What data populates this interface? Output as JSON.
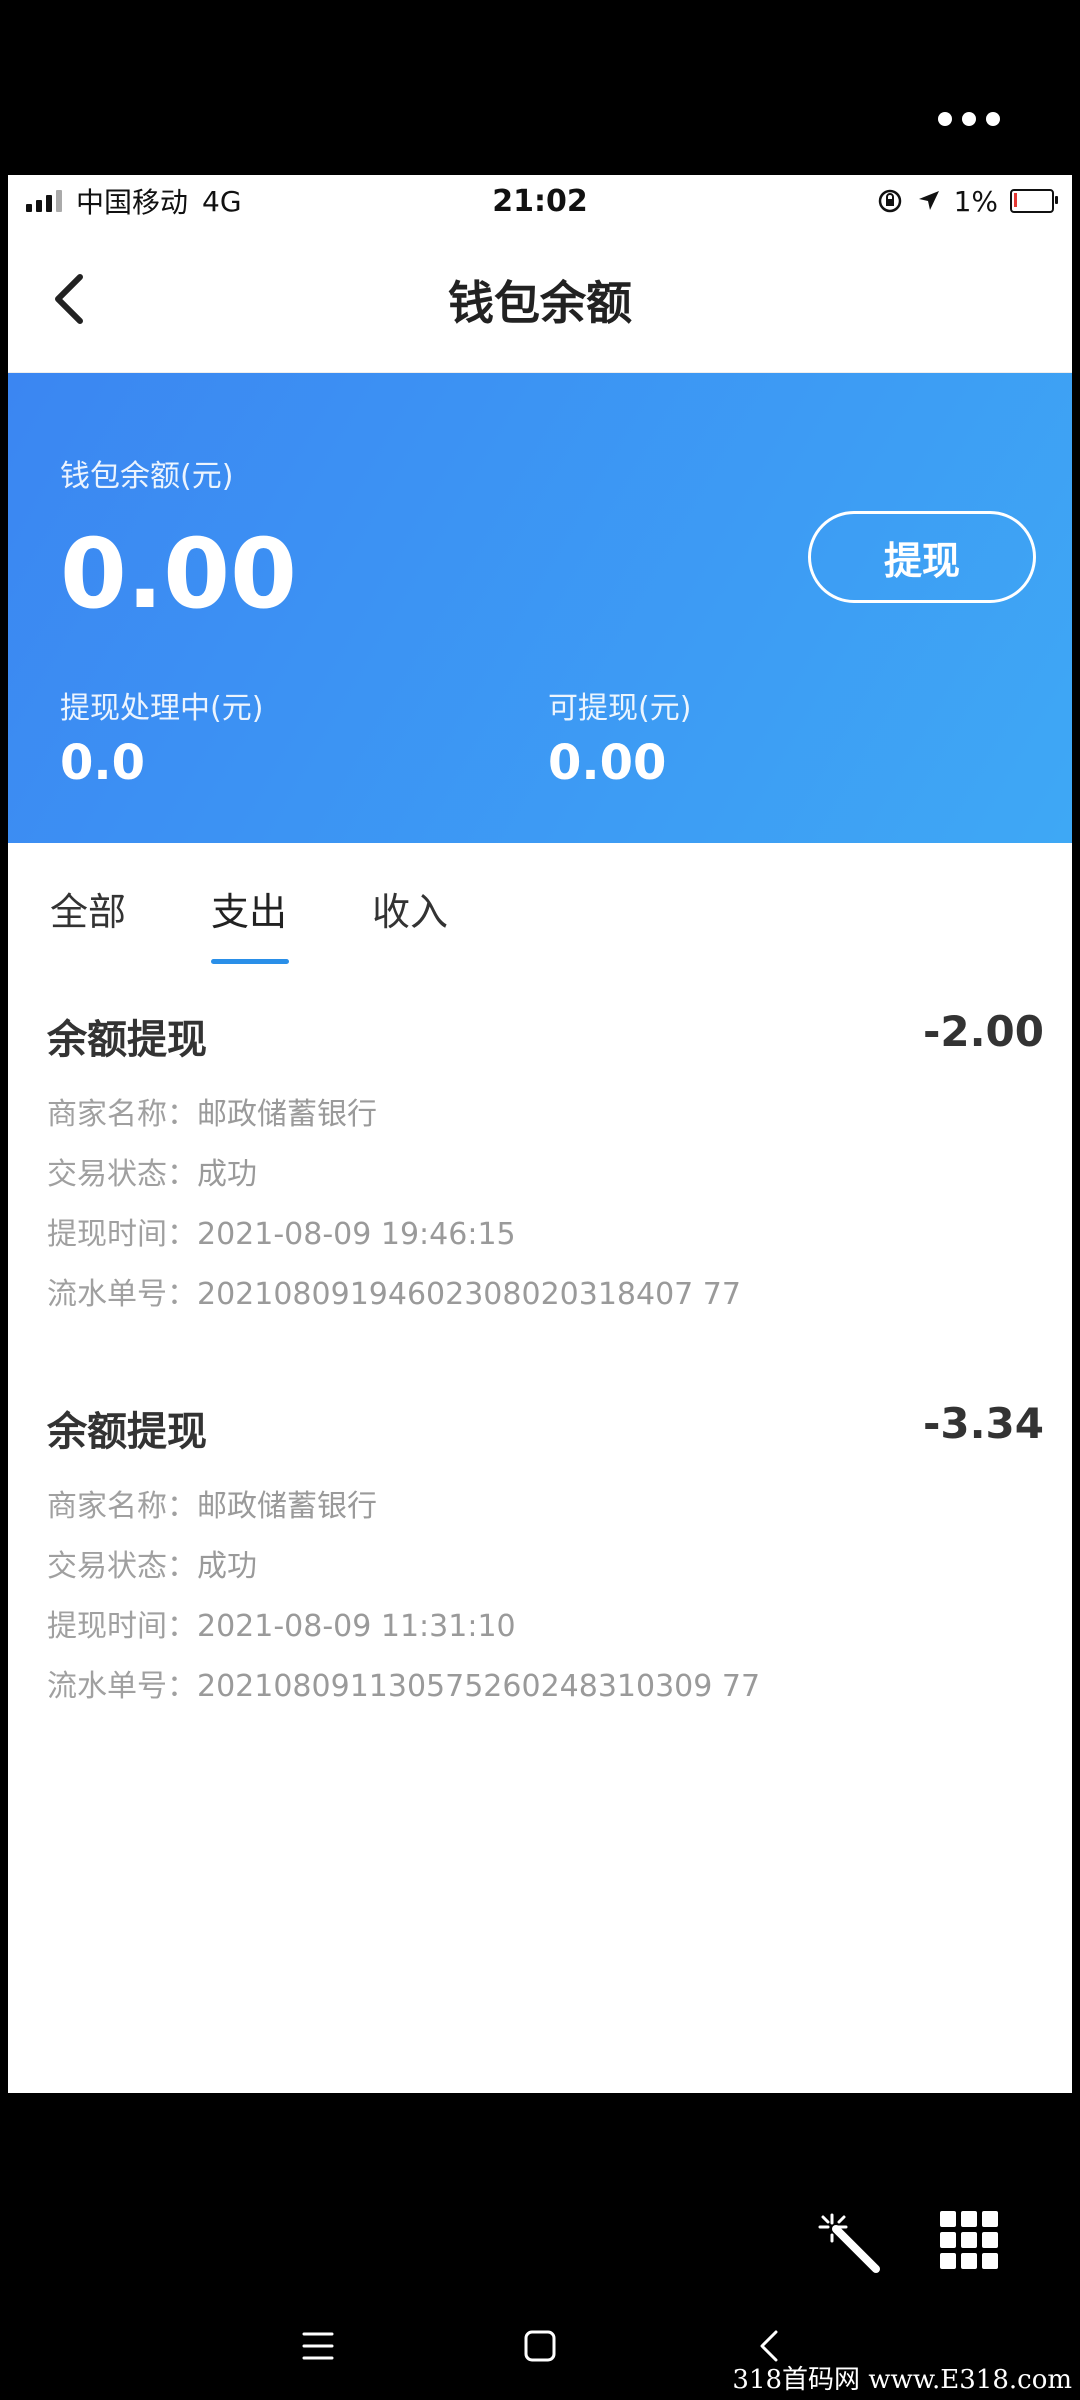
{
  "status": {
    "carrier": "中国移动",
    "network": "4G",
    "time": "21:02",
    "battery": "1%"
  },
  "nav": {
    "title": "钱包余额"
  },
  "wallet": {
    "balance_label": "钱包余额(元)",
    "balance": "0.00",
    "withdraw_button": "提现",
    "processing_label": "提现处理中(元)",
    "processing": "0.0",
    "available_label": "可提现(元)",
    "available": "0.00"
  },
  "tabs": [
    {
      "label": "全部"
    },
    {
      "label": "支出"
    },
    {
      "label": "收入"
    }
  ],
  "active_tab": "支出",
  "transactions": [
    {
      "title": "余额提现",
      "amount": "-2.00",
      "rows": [
        {
          "key": "商家名称：",
          "value": "邮政储蓄银行"
        },
        {
          "key": "交易状态：",
          "value": "成功"
        },
        {
          "key": "提现时间：",
          "value": "2021-08-09 19:46:15"
        },
        {
          "key": "流水单号：",
          "value": "20210809194602308020318407 77"
        }
      ]
    },
    {
      "title": "余额提现",
      "amount": "-3.34",
      "rows": [
        {
          "key": "商家名称：",
          "value": "邮政储蓄银行"
        },
        {
          "key": "交易状态：",
          "value": "成功"
        },
        {
          "key": "提现时间：",
          "value": "2021-08-09 11:31:10"
        },
        {
          "key": "流水单号：",
          "value": "202108091130575260248310309 77"
        }
      ]
    }
  ],
  "watermark": "318首码网 www.E318.com",
  "colors": {
    "accent": "#2a8fe8",
    "header_start": "#3b86f2",
    "header_end": "#3ea8f5"
  }
}
